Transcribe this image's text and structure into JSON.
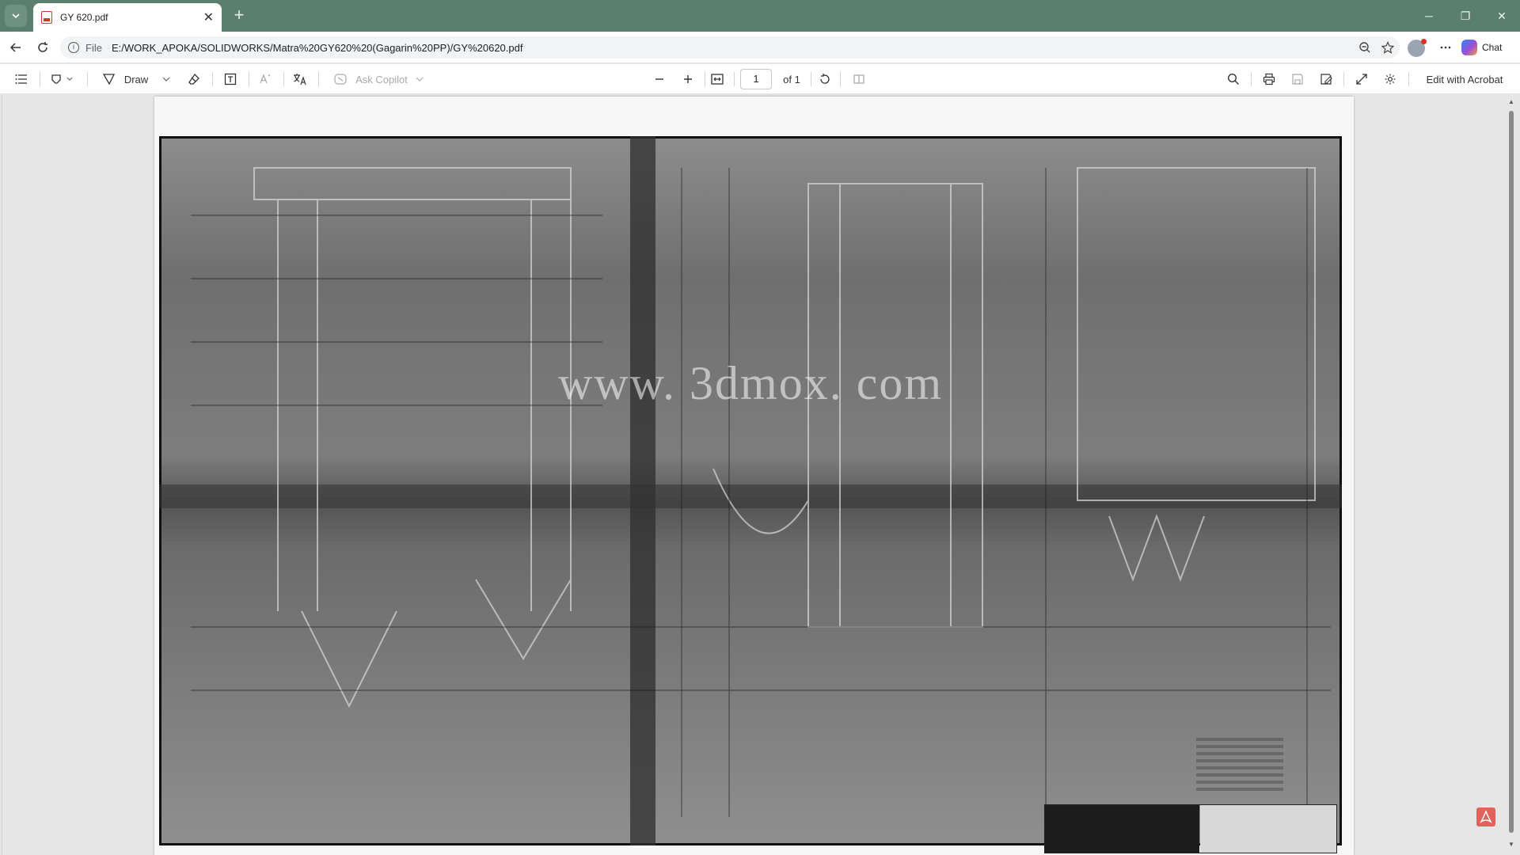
{
  "browser": {
    "tab": {
      "title": "GY 620.pdf",
      "close": "✕"
    },
    "new_tab": "+",
    "window_controls": {
      "minimize": "─",
      "restore": "❐",
      "close": "✕"
    },
    "address": {
      "scheme": "File",
      "url": "E:/WORK_APOKA/SOLIDWORKS/Matra%20GY620%20(Gagarin%20PP)/GY%20620.pdf"
    },
    "chat_label": "Chat"
  },
  "pdf_toolbar": {
    "draw_label": "Draw",
    "ask_copilot_label": "Ask Copilot",
    "page_number": "1",
    "page_total": "of 1",
    "edit_acrobat_label": "Edit with Acrobat"
  },
  "document": {
    "watermark": "www. 3dmox. com"
  },
  "icons": {
    "tab_menu": "chevron-down-icon",
    "back": "arrow-left-icon",
    "reload": "reload-icon",
    "info": "info-icon",
    "zoom": "zoom-out-icon",
    "favorite": "star-icon",
    "more": "more-icon",
    "contents": "list-icon",
    "highlight": "highlighter-icon",
    "draw": "pen-icon",
    "erase": "eraser-icon",
    "text": "text-box-icon",
    "read_aloud": "read-aloud-icon",
    "translate": "translate-icon",
    "zoom_out": "minus-icon",
    "zoom_in": "plus-icon",
    "fit": "fit-page-icon",
    "rotate": "rotate-icon",
    "page_view": "page-view-icon",
    "search": "search-icon",
    "print": "print-icon",
    "save": "save-icon",
    "save_as": "save-as-icon",
    "fullscreen": "expand-icon",
    "settings": "gear-icon"
  }
}
